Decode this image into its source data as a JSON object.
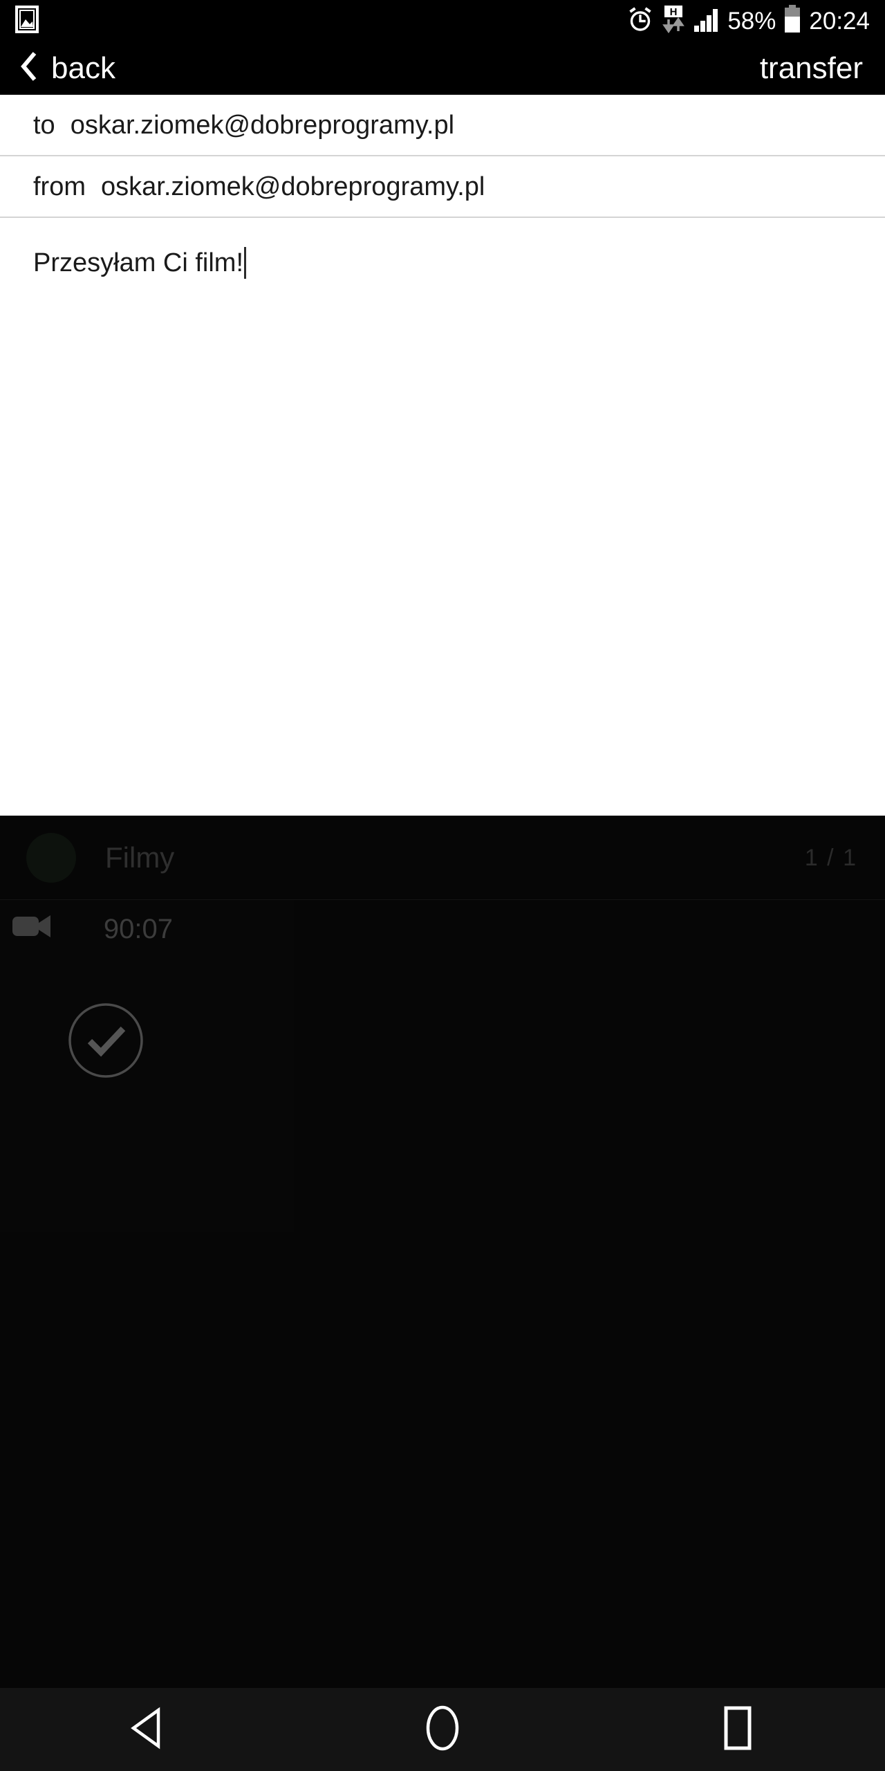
{
  "status_bar": {
    "notification_icon": "photo-icon",
    "alarm_icon": "alarm-clock-icon",
    "data_icon": "hspa-data-icon",
    "data_label": "H",
    "signal_icon": "signal-bars-icon",
    "battery_percent": "58%",
    "battery_icon": "battery-icon",
    "clock": "20:24"
  },
  "app_bar": {
    "back_label": "back",
    "back_icon": "chevron-left-icon",
    "transfer_label": "transfer"
  },
  "compose": {
    "to": {
      "label": "to",
      "value": "oskar.ziomek@dobreprogramy.pl"
    },
    "from": {
      "label": "from",
      "value": "oskar.ziomek@dobreprogramy.pl"
    },
    "message": {
      "value": "Przesyłam Ci film!"
    }
  },
  "picker": {
    "album": {
      "title": "Filmy",
      "count": "1 / 1",
      "avatar_icon": "album-avatar-icon"
    },
    "tiles": [
      {
        "type_icon": "video-camera-icon",
        "duration": "90:07",
        "selected": true,
        "check_icon": "check-circle-icon"
      }
    ]
  },
  "nav_bar": {
    "back_icon": "nav-back-triangle-icon",
    "home_icon": "nav-home-circle-icon",
    "recents_icon": "nav-recents-square-icon"
  },
  "colors": {
    "status_bar_bg": "#000000",
    "app_bar_bg": "#000000",
    "compose_bg": "#ffffff",
    "picker_bg": "#060606",
    "nav_bar_bg": "#141414",
    "text_light": "#ffffff",
    "text_dark": "#1a1a1a",
    "muted": "#2f2f2f"
  }
}
